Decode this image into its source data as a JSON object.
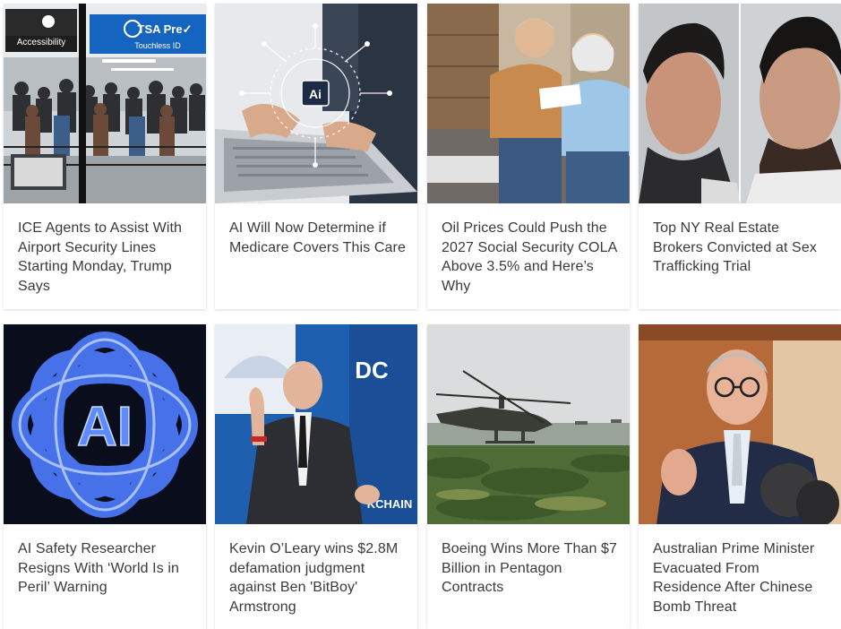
{
  "colors": {
    "card_background": "#ffffff",
    "title_text": "#3a3a3a",
    "tsa_blue": "#1565c0",
    "ai_glow": "#4d7cff"
  },
  "sign_text": {
    "accessibility": "Accessibility",
    "tsa_pre": "TSA Pre✓",
    "touchless_id": "Touchless ID",
    "ai_chip": "Ai",
    "ai_logo": "AI",
    "dc": "DC",
    "blockchain": "KCHAIN"
  },
  "articles": [
    {
      "title": "ICE Agents to Assist With Airport Security Lines Starting Monday, Trump Says",
      "image": "airport-security-line"
    },
    {
      "title": "AI Will Now Determine if Medicare Covers This Care",
      "image": "ai-laptop"
    },
    {
      "title": "Oil Prices Could Push the 2027 Social Security COLA Above 3.5% and Here’s Why",
      "image": "elderly-couple"
    },
    {
      "title": "Top NY Real Estate Brokers Convicted at Sex Trafficking Trial",
      "image": "two-men-mugshots"
    },
    {
      "title": "AI Safety Researcher Resigns With ‘World Is in Peril’ Warning",
      "image": "ai-neon-logo"
    },
    {
      "title": "Kevin O’Leary wins $2.8M defamation judgment against Ben 'BitBoy' Armstrong",
      "image": "speaker-on-stage"
    },
    {
      "title": "Boeing Wins More Than $7 Billion in Pentagon Contracts",
      "image": "helicopters"
    },
    {
      "title": "Australian Prime Minister Evacuated From Residence After Chinese Bomb Threat",
      "image": "prime-minister-speaking"
    }
  ]
}
